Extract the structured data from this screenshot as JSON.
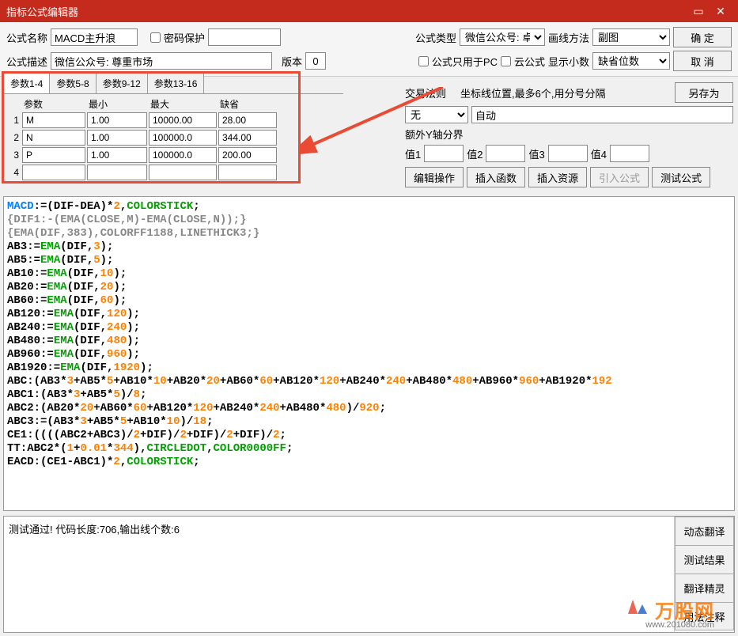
{
  "window": {
    "title": "指标公式编辑器"
  },
  "toolbar": {
    "name_label": "公式名称",
    "name_value": "MACD主升浪",
    "pwd_label": "密码保护",
    "type_label": "公式类型",
    "type_value": "微信公众号: 卓",
    "draw_label": "画线方法",
    "draw_value": "副图",
    "ok": "确  定",
    "desc_label": "公式描述",
    "desc_value": "微信公众号: 尊重市场",
    "version_label": "版本",
    "version_value": "0",
    "pc_only": "公式只用于PC",
    "cloud": "云公式",
    "decimals_label": "显示小数",
    "decimals_value": "缺省位数",
    "cancel": "取  消",
    "saveas": "另存为"
  },
  "tabs": {
    "t1": "参数1-4",
    "t2": "参数5-8",
    "t3": "参数9-12",
    "t4": "参数13-16"
  },
  "param": {
    "h_name": "参数",
    "h_min": "最小",
    "h_max": "最大",
    "h_def": "缺省",
    "rows": [
      {
        "n": "1",
        "name": "M",
        "min": "1.00",
        "max": "10000.00",
        "def": "28.00"
      },
      {
        "n": "2",
        "name": "N",
        "min": "1.00",
        "max": "100000.0",
        "def": "344.00"
      },
      {
        "n": "3",
        "name": "P",
        "min": "1.00",
        "max": "100000.0",
        "def": "200.00"
      },
      {
        "n": "4",
        "name": "",
        "min": "",
        "max": "",
        "def": ""
      }
    ]
  },
  "right": {
    "trade_rule": "交易法则",
    "coord_label": "坐标线位置,最多6个,用分号分隔",
    "no": "无",
    "auto": "自动",
    "extra_y": "额外Y轴分界",
    "v1": "值1",
    "v2": "值2",
    "v3": "值3",
    "v4": "值4",
    "edit_op": "编辑操作",
    "ins_func": "插入函数",
    "ins_res": "插入资源",
    "import_formula": "引入公式",
    "test_formula": "测试公式"
  },
  "code_lines": [
    {
      "parts": [
        {
          "c": "c-blue",
          "t": "MACD"
        },
        {
          "t": ":=(DIF-DEA)*"
        },
        {
          "c": "c-orange",
          "t": "2"
        },
        {
          "t": ","
        },
        {
          "c": "c-green",
          "t": "COLORSTICK"
        },
        {
          "t": ";"
        }
      ]
    },
    {
      "parts": [
        {
          "c": "c-gray",
          "t": "{DIF1:-(EMA(CLOSE,M)-EMA(CLOSE,N));}"
        }
      ]
    },
    {
      "parts": [
        {
          "c": "c-gray",
          "t": "{EMA(DIF,383),COLORFF1188,LINETHICK3;}"
        }
      ]
    },
    {
      "parts": [
        {
          "t": "AB3:="
        },
        {
          "c": "c-green",
          "t": "EMA"
        },
        {
          "t": "(DIF,"
        },
        {
          "c": "c-orange",
          "t": "3"
        },
        {
          "t": ");"
        }
      ]
    },
    {
      "parts": [
        {
          "t": "AB5:="
        },
        {
          "c": "c-green",
          "t": "EMA"
        },
        {
          "t": "(DIF,"
        },
        {
          "c": "c-orange",
          "t": "5"
        },
        {
          "t": ");"
        }
      ]
    },
    {
      "parts": [
        {
          "t": "AB10:="
        },
        {
          "c": "c-green",
          "t": "EMA"
        },
        {
          "t": "(DIF,"
        },
        {
          "c": "c-orange",
          "t": "10"
        },
        {
          "t": ");"
        }
      ]
    },
    {
      "parts": [
        {
          "t": "AB20:="
        },
        {
          "c": "c-green",
          "t": "EMA"
        },
        {
          "t": "(DIF,"
        },
        {
          "c": "c-orange",
          "t": "20"
        },
        {
          "t": ");"
        }
      ]
    },
    {
      "parts": [
        {
          "t": "AB60:="
        },
        {
          "c": "c-green",
          "t": "EMA"
        },
        {
          "t": "(DIF,"
        },
        {
          "c": "c-orange",
          "t": "60"
        },
        {
          "t": ");"
        }
      ]
    },
    {
      "parts": [
        {
          "t": "AB120:="
        },
        {
          "c": "c-green",
          "t": "EMA"
        },
        {
          "t": "(DIF,"
        },
        {
          "c": "c-orange",
          "t": "120"
        },
        {
          "t": ");"
        }
      ]
    },
    {
      "parts": [
        {
          "t": "AB240:="
        },
        {
          "c": "c-green",
          "t": "EMA"
        },
        {
          "t": "(DIF,"
        },
        {
          "c": "c-orange",
          "t": "240"
        },
        {
          "t": ");"
        }
      ]
    },
    {
      "parts": [
        {
          "t": "AB480:="
        },
        {
          "c": "c-green",
          "t": "EMA"
        },
        {
          "t": "(DIF,"
        },
        {
          "c": "c-orange",
          "t": "480"
        },
        {
          "t": ");"
        }
      ]
    },
    {
      "parts": [
        {
          "t": "AB960:="
        },
        {
          "c": "c-green",
          "t": "EMA"
        },
        {
          "t": "(DIF,"
        },
        {
          "c": "c-orange",
          "t": "960"
        },
        {
          "t": ");"
        }
      ]
    },
    {
      "parts": [
        {
          "t": "AB1920:="
        },
        {
          "c": "c-green",
          "t": "EMA"
        },
        {
          "t": "(DIF,"
        },
        {
          "c": "c-orange",
          "t": "1920"
        },
        {
          "t": ");"
        }
      ]
    },
    {
      "parts": [
        {
          "t": "ABC:(AB3*"
        },
        {
          "c": "c-orange",
          "t": "3"
        },
        {
          "t": "+AB5*"
        },
        {
          "c": "c-orange",
          "t": "5"
        },
        {
          "t": "+AB10*"
        },
        {
          "c": "c-orange",
          "t": "10"
        },
        {
          "t": "+AB20*"
        },
        {
          "c": "c-orange",
          "t": "20"
        },
        {
          "t": "+AB60*"
        },
        {
          "c": "c-orange",
          "t": "60"
        },
        {
          "t": "+AB120*"
        },
        {
          "c": "c-orange",
          "t": "120"
        },
        {
          "t": "+AB240*"
        },
        {
          "c": "c-orange",
          "t": "240"
        },
        {
          "t": "+AB480*"
        },
        {
          "c": "c-orange",
          "t": "480"
        },
        {
          "t": "+AB960*"
        },
        {
          "c": "c-orange",
          "t": "960"
        },
        {
          "t": "+AB1920*"
        },
        {
          "c": "c-orange",
          "t": "192"
        }
      ]
    },
    {
      "parts": [
        {
          "t": "ABC1:(AB3*"
        },
        {
          "c": "c-orange",
          "t": "3"
        },
        {
          "t": "+AB5*"
        },
        {
          "c": "c-orange",
          "t": "5"
        },
        {
          "t": ")/"
        },
        {
          "c": "c-orange",
          "t": "8"
        },
        {
          "t": ";"
        }
      ]
    },
    {
      "parts": [
        {
          "t": "ABC2:(AB20*"
        },
        {
          "c": "c-orange",
          "t": "20"
        },
        {
          "t": "+AB60*"
        },
        {
          "c": "c-orange",
          "t": "60"
        },
        {
          "t": "+AB120*"
        },
        {
          "c": "c-orange",
          "t": "120"
        },
        {
          "t": "+AB240*"
        },
        {
          "c": "c-orange",
          "t": "240"
        },
        {
          "t": "+AB480*"
        },
        {
          "c": "c-orange",
          "t": "480"
        },
        {
          "t": ")/"
        },
        {
          "c": "c-orange",
          "t": "920"
        },
        {
          "t": ";"
        }
      ]
    },
    {
      "parts": [
        {
          "t": "ABC3:=(AB3*"
        },
        {
          "c": "c-orange",
          "t": "3"
        },
        {
          "t": "+AB5*"
        },
        {
          "c": "c-orange",
          "t": "5"
        },
        {
          "t": "+AB10*"
        },
        {
          "c": "c-orange",
          "t": "10"
        },
        {
          "t": ")/"
        },
        {
          "c": "c-orange",
          "t": "18"
        },
        {
          "t": ";"
        }
      ]
    },
    {
      "parts": [
        {
          "t": "CE1:((((ABC2+ABC3)/"
        },
        {
          "c": "c-orange",
          "t": "2"
        },
        {
          "t": "+DIF)/"
        },
        {
          "c": "c-orange",
          "t": "2"
        },
        {
          "t": "+DIF)/"
        },
        {
          "c": "c-orange",
          "t": "2"
        },
        {
          "t": "+DIF)/"
        },
        {
          "c": "c-orange",
          "t": "2"
        },
        {
          "t": ";"
        }
      ]
    },
    {
      "parts": [
        {
          "t": "TT:ABC2*("
        },
        {
          "c": "c-orange",
          "t": "1"
        },
        {
          "t": "+"
        },
        {
          "c": "c-orange",
          "t": "0.01"
        },
        {
          "t": "*"
        },
        {
          "c": "c-orange",
          "t": "344"
        },
        {
          "t": "),"
        },
        {
          "c": "c-green",
          "t": "CIRCLEDOT"
        },
        {
          "t": ","
        },
        {
          "c": "c-green",
          "t": "COLOR0000FF"
        },
        {
          "t": ";"
        }
      ]
    },
    {
      "parts": [
        {
          "t": "EACD:(CE1-ABC1)*"
        },
        {
          "c": "c-orange",
          "t": "2"
        },
        {
          "t": ","
        },
        {
          "c": "c-green",
          "t": "COLORSTICK"
        },
        {
          "t": ";"
        }
      ]
    }
  ],
  "status": {
    "msg": "测试通过! 代码长度:706,输出线个数:6",
    "b1": "动态翻译",
    "b2": "测试结果",
    "b3": "翻译精灵",
    "b4": "用法注释"
  },
  "watermark": {
    "brand": "万股网",
    "sub": "www.201080.com"
  }
}
